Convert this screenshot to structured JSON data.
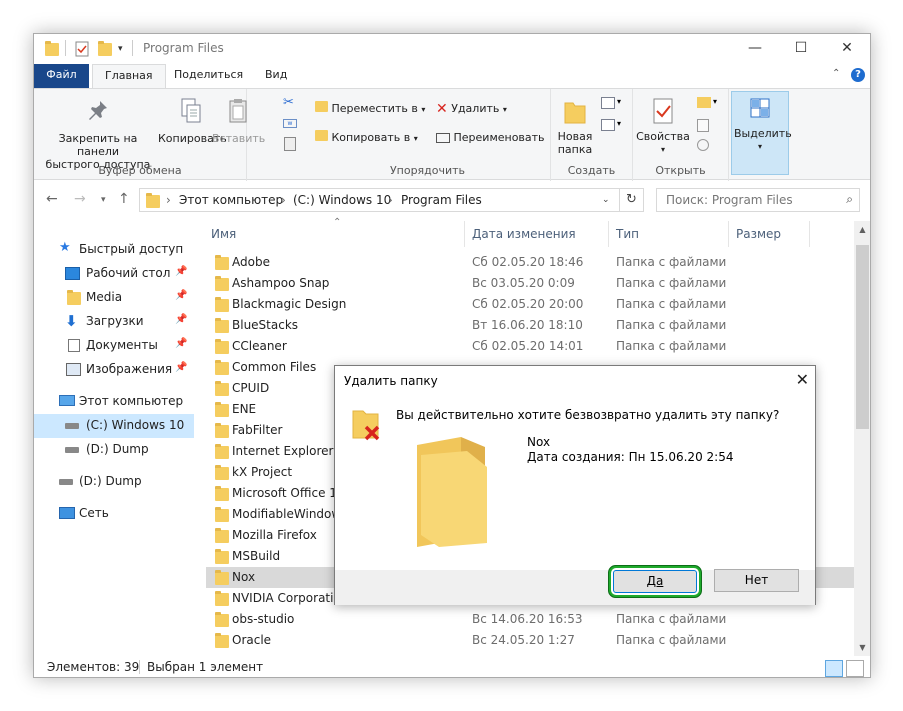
{
  "window": {
    "title": "Program Files",
    "minimize": "—",
    "maximize": "☐",
    "close": "✕"
  },
  "tabs": {
    "file": "Файл",
    "home": "Главная",
    "share": "Поделиться",
    "view": "Вид"
  },
  "ribbon": {
    "pin_label_1": "Закрепить на панели",
    "pin_label_2": "быстрого доступа",
    "copy": "Копировать",
    "paste": "Вставить",
    "clipboard_group": "Буфер обмена",
    "move_to": "Переместить в",
    "copy_to": "Копировать в",
    "delete": "Удалить",
    "rename": "Переименовать",
    "organize_group": "Упорядочить",
    "new_folder_1": "Новая",
    "new_folder_2": "папка",
    "create_group": "Создать",
    "properties": "Свойства",
    "open_group": "Открыть",
    "select": "Выделить"
  },
  "address": {
    "this_pc": "Этот компьютер",
    "drive": "(C:) Windows 10",
    "folder": "Program Files",
    "search_placeholder": "Поиск: Program Files"
  },
  "nav": {
    "quick_access": "Быстрый доступ",
    "desktop": "Рабочий стол",
    "media": "Media",
    "downloads": "Загрузки",
    "documents": "Документы",
    "pictures": "Изображения",
    "this_pc": "Этот компьютер",
    "drive_c": "(C:) Windows 10",
    "drive_d_sub": "(D:) Dump",
    "drive_d": "(D:) Dump",
    "network": "Сеть"
  },
  "columns": {
    "name": "Имя",
    "date": "Дата изменения",
    "type": "Тип",
    "size": "Размер"
  },
  "files": [
    {
      "name": "Adobe",
      "date": "Сб 02.05.20 18:46",
      "type": "Папка с файлами"
    },
    {
      "name": "Ashampoo Snap",
      "date": "Вс 03.05.20 0:09",
      "type": "Папка с файлами"
    },
    {
      "name": "Blackmagic Design",
      "date": "Сб 02.05.20 20:00",
      "type": "Папка с файлами"
    },
    {
      "name": "BlueStacks",
      "date": "Вт 16.06.20 18:10",
      "type": "Папка с файлами"
    },
    {
      "name": "CCleaner",
      "date": "Сб 02.05.20 14:01",
      "type": "Папка с файлами"
    },
    {
      "name": "Common Files",
      "date": "",
      "type": ""
    },
    {
      "name": "CPUID",
      "date": "",
      "type": ""
    },
    {
      "name": "ENE",
      "date": "",
      "type": ""
    },
    {
      "name": "FabFilter",
      "date": "",
      "type": ""
    },
    {
      "name": "Internet Explorer",
      "date": "",
      "type": ""
    },
    {
      "name": "kX Project",
      "date": "",
      "type": ""
    },
    {
      "name": "Microsoft Office 15",
      "date": "",
      "type": ""
    },
    {
      "name": "ModifiableWindows",
      "date": "",
      "type": ""
    },
    {
      "name": "Mozilla Firefox",
      "date": "",
      "type": ""
    },
    {
      "name": "MSBuild",
      "date": "",
      "type": ""
    },
    {
      "name": "Nox",
      "date": "",
      "type": ""
    },
    {
      "name": "NVIDIA Corporation",
      "date": "",
      "type": ""
    },
    {
      "name": "obs-studio",
      "date": "Вс 14.06.20 16:53",
      "type": "Папка с файлами"
    },
    {
      "name": "Oracle",
      "date": "Вс 24.05.20 1:27",
      "type": "Папка с файлами"
    }
  ],
  "status": {
    "items": "Элементов: 39",
    "selected": "Выбран 1 элемент"
  },
  "dialog": {
    "title": "Удалить папку",
    "question": "Вы действительно хотите безвозвратно удалить эту папку?",
    "folder_name": "Nox",
    "created": "Дата создания: Пн 15.06.20 2:54",
    "yes": "Да",
    "no": "Нет"
  },
  "colors": {
    "file_tab": "#19478a",
    "selection": "#cce8ff",
    "highlight_ring": "#1faa2c",
    "folder": "#f5cd5f"
  }
}
